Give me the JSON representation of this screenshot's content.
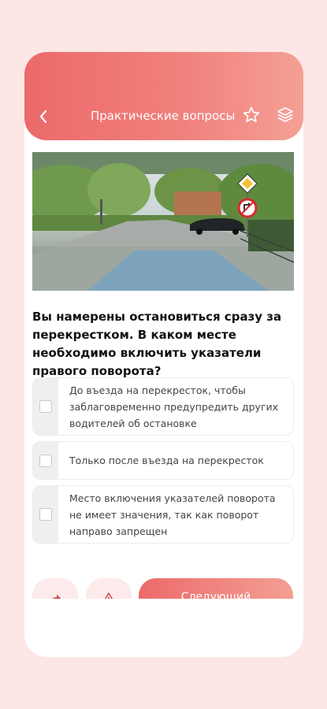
{
  "header": {
    "title": "Практические вопросы",
    "back_icon": "chevron-left-icon",
    "star_icon": "star-icon",
    "layers_icon": "layers-icon",
    "gradient": [
      "#ec6a6a",
      "#f4a095"
    ]
  },
  "question": {
    "text": "Вы намерены остановиться сразу за перекрестком. В каком месте необходимо включить указатели правого поворота?"
  },
  "options": [
    {
      "text": "До въезда на перекресток, чтобы заблаговременно предупредить других водителей об остановке",
      "checked": false
    },
    {
      "text": "Только после въезда на перекресток",
      "checked": false
    },
    {
      "text": "Место включения указателей поворота не имеет значения, так как поворот направо запрещен",
      "checked": false
    }
  ],
  "actions": {
    "share_icon": "share-icon",
    "report_icon": "warning-icon",
    "next_label": "Следующий"
  },
  "colors": {
    "background": "#fde6e6",
    "accent": "#ec6a6a"
  }
}
